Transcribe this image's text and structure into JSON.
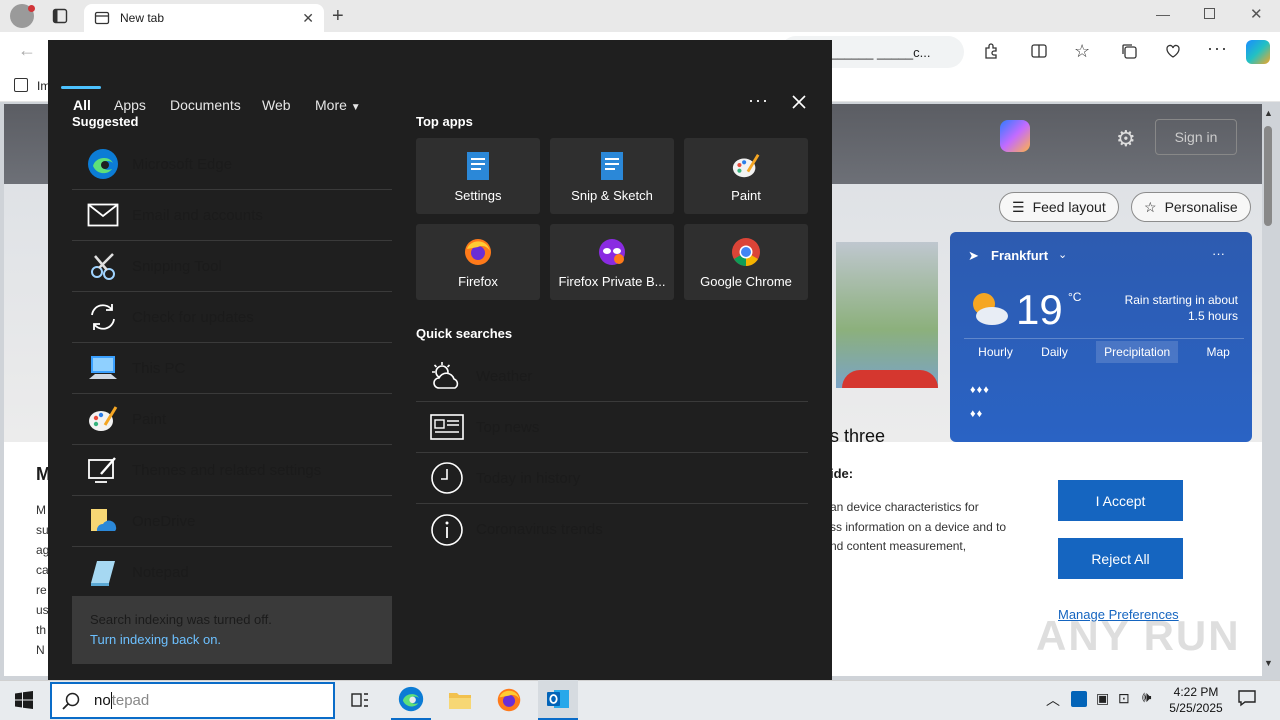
{
  "browser": {
    "tab_title": "New tab",
    "address_tail": "______ _____c...",
    "favorites_first": "Im",
    "sign_in": "Sign in",
    "feed_layout": "Feed layout",
    "personalise": "Personalise",
    "headline_fragment": "s three"
  },
  "weather": {
    "city": "Frankfurt",
    "temp": "19",
    "unit": "°C",
    "desc_line1": "Rain starting in about",
    "desc_line2": "1.5 hours",
    "tabs": [
      "Hourly",
      "Daily",
      "Precipitation",
      "Map"
    ]
  },
  "consent": {
    "heading_fragment": "ide:",
    "line1": "an device characteristics for",
    "line2": "ss information on a device and to",
    "line3": "nd content measurement,",
    "left_letters": [
      "M",
      "M",
      "su",
      "ag",
      "ca",
      "re",
      "us",
      "th",
      "N"
    ],
    "accept": "I Accept",
    "reject": "Reject All",
    "manage": "Manage Preferences"
  },
  "search_panel": {
    "tabs": [
      "All",
      "Apps",
      "Documents",
      "Web",
      "More"
    ],
    "suggested_title": "Suggested",
    "suggested": [
      {
        "label": "Microsoft Edge",
        "icon": "edge-icon"
      },
      {
        "label": "Email and accounts",
        "icon": "mail-icon"
      },
      {
        "label": "Snipping Tool",
        "icon": "snipping-tool-icon"
      },
      {
        "label": "Check for updates",
        "icon": "sync-icon"
      },
      {
        "label": "This PC",
        "icon": "computer-icon"
      },
      {
        "label": "Paint",
        "icon": "paint-icon"
      },
      {
        "label": "Themes and related settings",
        "icon": "themes-icon"
      },
      {
        "label": "OneDrive",
        "icon": "onedrive-icon"
      },
      {
        "label": "Notepad",
        "icon": "notepad-icon"
      }
    ],
    "top_apps_title": "Top apps",
    "top_apps": [
      {
        "label": "Settings",
        "icon": "settings-doc-icon"
      },
      {
        "label": "Snip & Sketch",
        "icon": "snip-sketch-icon"
      },
      {
        "label": "Paint",
        "icon": "paint-icon"
      },
      {
        "label": "Firefox",
        "icon": "firefox-icon"
      },
      {
        "label": "Firefox Private B...",
        "icon": "firefox-private-icon"
      },
      {
        "label": "Google Chrome",
        "icon": "chrome-icon"
      }
    ],
    "quick_title": "Quick searches",
    "quick": [
      {
        "label": "Weather",
        "icon": "weather-icon"
      },
      {
        "label": "Top news",
        "icon": "news-icon"
      },
      {
        "label": "Today in history",
        "icon": "clock-icon"
      },
      {
        "label": "Coronavirus trends",
        "icon": "info-icon"
      }
    ],
    "index_msg": "Search indexing was turned off.",
    "index_link": "Turn indexing back on."
  },
  "taskbar": {
    "search_typed": "no",
    "search_suggest": "tepad",
    "time": "4:22 PM",
    "date": "5/25/2025"
  },
  "watermark": "ANY RUN"
}
